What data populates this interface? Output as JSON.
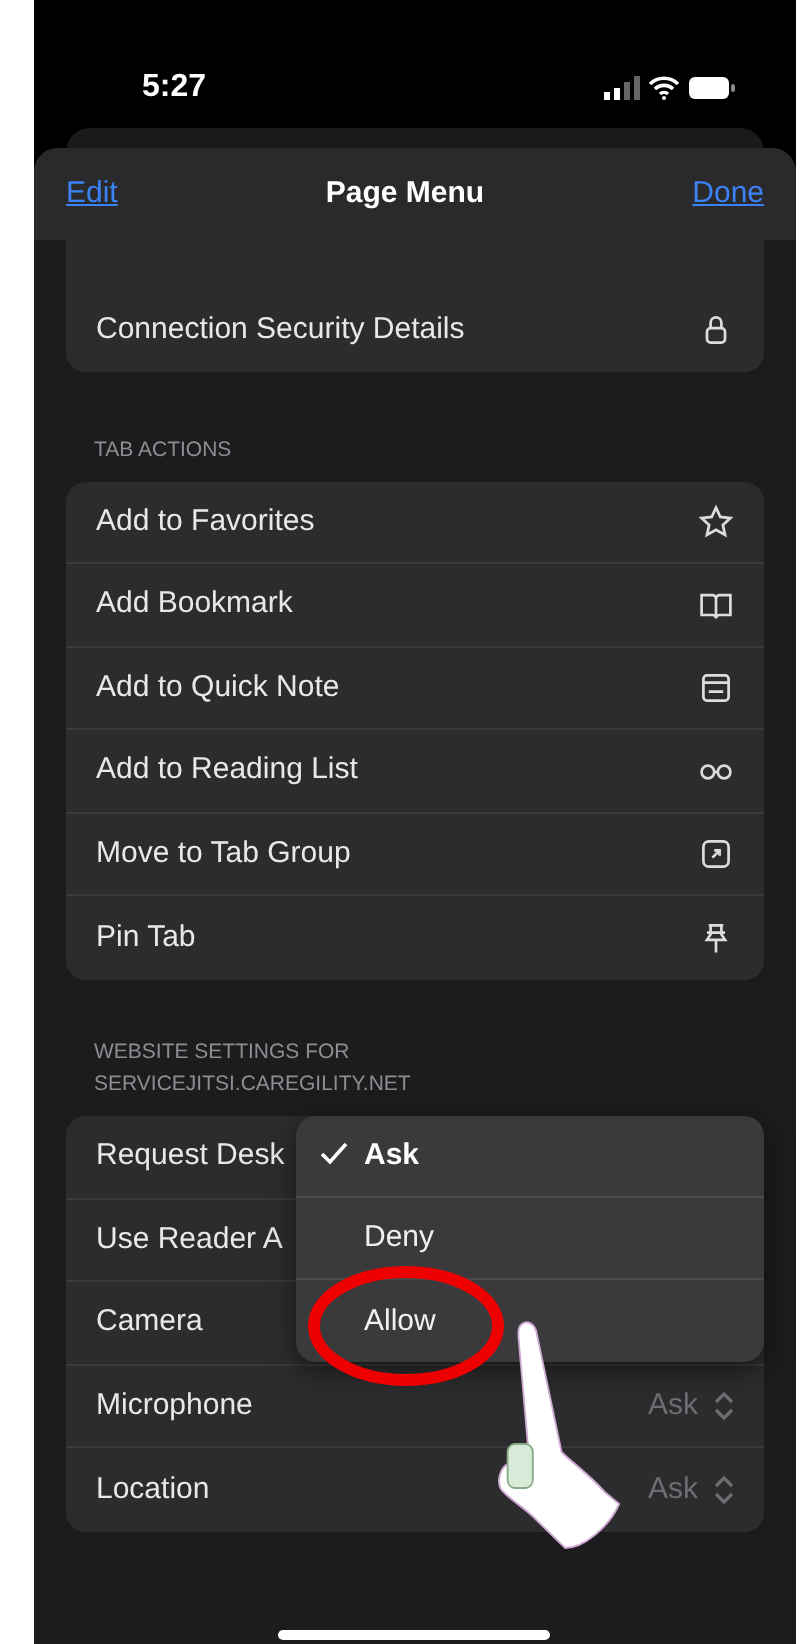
{
  "status_bar": {
    "time": "5:27"
  },
  "nav": {
    "left": "Edit",
    "title": "Page Menu",
    "right": "Done"
  },
  "top_rows": [
    {
      "label": "Connection Security Details"
    }
  ],
  "tab_actions": {
    "header": "TAB ACTIONS",
    "rows": [
      {
        "label": "Add to Favorites"
      },
      {
        "label": "Add Bookmark"
      },
      {
        "label": "Add to Quick Note"
      },
      {
        "label": "Add to Reading List"
      },
      {
        "label": "Move to Tab Group"
      },
      {
        "label": "Pin Tab"
      }
    ]
  },
  "website_settings": {
    "header": "WEBSITE SETTINGS FOR SERVICEJITSI.CAREGILITY.NET",
    "rows": [
      {
        "label": "Request Desk"
      },
      {
        "label": "Use Reader A"
      },
      {
        "label": "Camera"
      },
      {
        "label": "Microphone",
        "value": "Ask"
      },
      {
        "label": "Location",
        "value": "Ask"
      }
    ]
  },
  "popup_menu": {
    "options": [
      {
        "label": "Ask",
        "selected": true
      },
      {
        "label": "Deny",
        "selected": false
      },
      {
        "label": "Allow",
        "selected": false
      }
    ]
  }
}
